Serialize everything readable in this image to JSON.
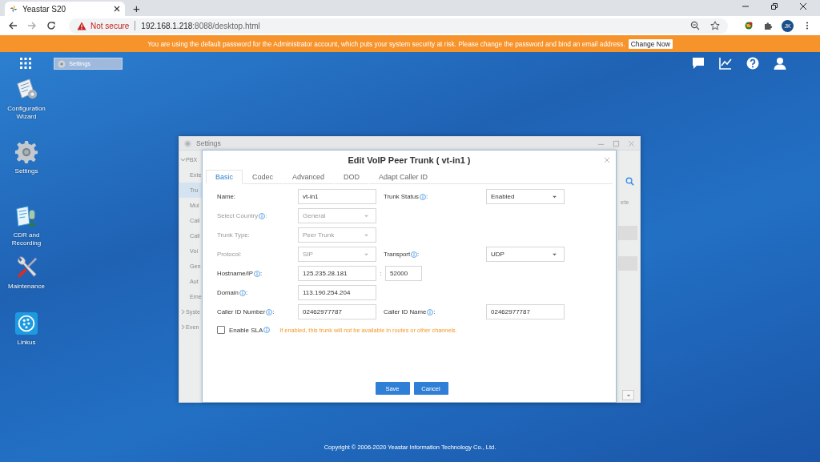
{
  "browser": {
    "tabs": [
      {
        "title": "Yeastar S20",
        "selected": true
      }
    ],
    "new_tab": "+",
    "security": "Not secure",
    "url_host": "192.168.1.218",
    "url_rest": ":8088/desktop.html",
    "profile": "JK"
  },
  "banner": {
    "message": "You are using the default password for the Administrator account, which puts your system security at risk. Please change the password and bind an email address.",
    "button": "Change Now"
  },
  "taskbar": {
    "items": [
      {
        "label": "Settings",
        "selected": true
      }
    ]
  },
  "desktop_icons": [
    {
      "kind": "wizard",
      "label": "Configuration Wizard"
    },
    {
      "kind": "settings",
      "label": "Settings"
    },
    {
      "kind": "cdr",
      "label": "CDR and Recording"
    },
    {
      "kind": "maintenance",
      "label": "Maintenance"
    },
    {
      "kind": "linkus",
      "label": "Linkus"
    }
  ],
  "settings_window": {
    "title": "Settings",
    "tree": [
      {
        "label": "PBX",
        "expanded": true,
        "children": [
          {
            "label": "Exte",
            "selected": false
          },
          {
            "label": "Tru",
            "selected": true
          },
          {
            "label": "Mul",
            "selected": false
          },
          {
            "label": "Call",
            "selected": false
          },
          {
            "label": "Call",
            "selected": false
          },
          {
            "label": "Voi",
            "selected": false
          },
          {
            "label": "Gen",
            "selected": false
          },
          {
            "label": "Aut",
            "selected": false
          },
          {
            "label": "Eme",
            "selected": false
          }
        ]
      },
      {
        "label": "Syste",
        "expanded": false
      },
      {
        "label": "Even",
        "expanded": false
      }
    ],
    "column_header": "ete"
  },
  "dialog": {
    "title": "Edit VoIP Peer Trunk ( vt-in1 )",
    "tabs": [
      {
        "label": "Basic",
        "selected": true
      },
      {
        "label": "Codec",
        "selected": false
      },
      {
        "label": "Advanced",
        "selected": false
      },
      {
        "label": "DOD",
        "selected": false
      },
      {
        "label": "Adapt Caller ID",
        "selected": false
      }
    ],
    "rows": [
      {
        "cells": [
          {
            "kind": "text",
            "label": "Name:",
            "info": false,
            "value": "vt-in1",
            "disabled": false
          },
          {
            "kind": "select",
            "label": "Trunk Status",
            "info": true,
            "colon": ":",
            "value": "Enabled",
            "disabled": false
          }
        ]
      },
      {
        "cells": [
          {
            "kind": "select",
            "label": "Select Country",
            "info": true,
            "colon": ":",
            "value": "General",
            "disabled": true
          }
        ]
      },
      {
        "cells": [
          {
            "kind": "select",
            "label": "Trunk Type:",
            "info": false,
            "value": "Peer Trunk",
            "disabled": true
          }
        ]
      },
      {
        "cells": [
          {
            "kind": "select",
            "label": "Protocol:",
            "info": false,
            "value": "SIP",
            "disabled": true
          },
          {
            "kind": "select",
            "label": "Transport",
            "info": true,
            "colon": ":",
            "value": "UDP",
            "disabled": false
          }
        ]
      },
      {
        "cells": [
          {
            "kind": "host",
            "label": "Hostname/IP",
            "info": true,
            "colon": ":",
            "value": "125.235.28.181",
            "separator": ":",
            "port": "52000",
            "disabled": false
          }
        ]
      },
      {
        "cells": [
          {
            "kind": "text",
            "label": "Domain",
            "info": true,
            "colon": ":",
            "value": "113.190.254.204",
            "disabled": false
          }
        ]
      },
      {
        "cells": [
          {
            "kind": "text",
            "label": "Caller ID Number",
            "info": true,
            "colon": ":",
            "value": "02462977787",
            "disabled": false
          },
          {
            "kind": "text",
            "label": "Caller ID Name",
            "info": true,
            "colon": ":",
            "value": "02462977787",
            "disabled": false
          }
        ]
      }
    ],
    "sla": {
      "label": "Enable SLA",
      "checked": false,
      "hint": "If enabled, this trunk will not be available in routes or other channels."
    },
    "buttons": [
      "Save",
      "Cancel"
    ]
  },
  "footer": "Copyright © 2006-2020 Yeastar Information Technology Co., Ltd."
}
